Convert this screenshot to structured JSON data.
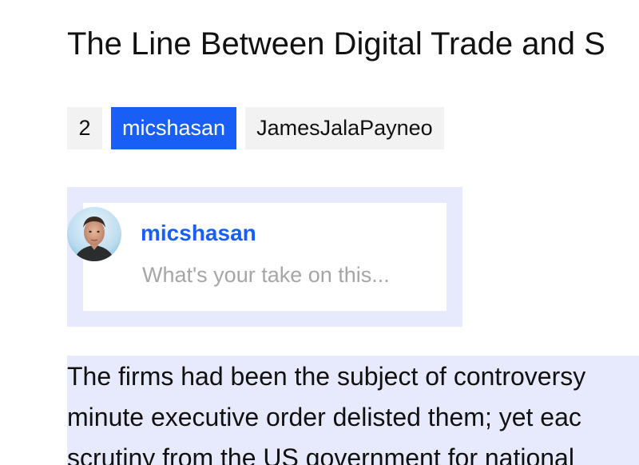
{
  "article": {
    "title": "The Line Between Digital Trade and S",
    "body_lines": [
      "The firms had been the subject of controversy",
      "minute executive order delisted them; yet eac",
      "scrutiny from the US government for national"
    ]
  },
  "user_tabs": {
    "count": "2",
    "active_user": "micshasan",
    "other_user": "JamesJalaPayneo"
  },
  "comment": {
    "username": "micshasan",
    "placeholder": "What's your take on this..."
  },
  "colors": {
    "accent": "#1a5ff5",
    "highlight": "#e6eafc",
    "tab_bg": "#f2f2f2"
  }
}
